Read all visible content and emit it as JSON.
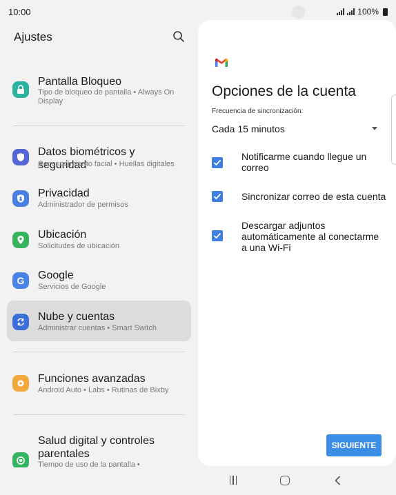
{
  "status_bar": {
    "time": "10:00",
    "battery_text": "100%"
  },
  "left_panel": {
    "title": "Ajustes",
    "items": [
      {
        "title": "Pantalla Bloqueo",
        "subtitle": "Tipo de bloqueo de pantalla  •  Always On Display",
        "icon": "lock-icon",
        "color": "#2bb3a0"
      },
      {
        "title": "Datos biométricos y seguridad",
        "subtitle": "Reconocimiento facial  •  Huellas digitales",
        "icon": "shield-icon",
        "color": "#5566d6"
      },
      {
        "title": "Privacidad",
        "subtitle": "Administrador de permisos",
        "icon": "privacy-shield-icon",
        "color": "#4a7fe0"
      },
      {
        "title": "Ubicación",
        "subtitle": "Solicitudes de ubicación",
        "icon": "location-pin-icon",
        "color": "#38b35e"
      },
      {
        "title": "Google",
        "subtitle": "Servicios de Google",
        "icon": "google-g-icon",
        "color": "#4a83e8"
      },
      {
        "title": "Nube y cuentas",
        "subtitle": "Administrar cuentas  •  Smart Switch",
        "icon": "sync-icon",
        "color": "#3b6ed8",
        "selected": true
      },
      {
        "title": "Funciones avanzadas",
        "subtitle": "Android Auto  •  Labs  •  Rutinas de Bixby",
        "icon": "gear-plus-icon",
        "color": "#f2a93b"
      },
      {
        "title": "Salud digital y controles parentales",
        "subtitle": "Tiempo de uso de la pantalla  •",
        "icon": "digital-wellbeing-icon",
        "color": "#35b361"
      }
    ]
  },
  "right_panel": {
    "title": "Opciones de la cuenta",
    "sync_label": "Frecuencia de sincronización:",
    "sync_value": "Cada 15 minutos",
    "options": [
      {
        "label": "Notificarme cuando llegue un correo",
        "checked": true
      },
      {
        "label": "Sincronizar correo de esta cuenta",
        "checked": true
      },
      {
        "label": "Descargar adjuntos automáticamente al conectarme a una Wi-Fi",
        "checked": true
      }
    ],
    "next_button": "SIGUIENTE",
    "accent_color": "#3a8ee6"
  }
}
